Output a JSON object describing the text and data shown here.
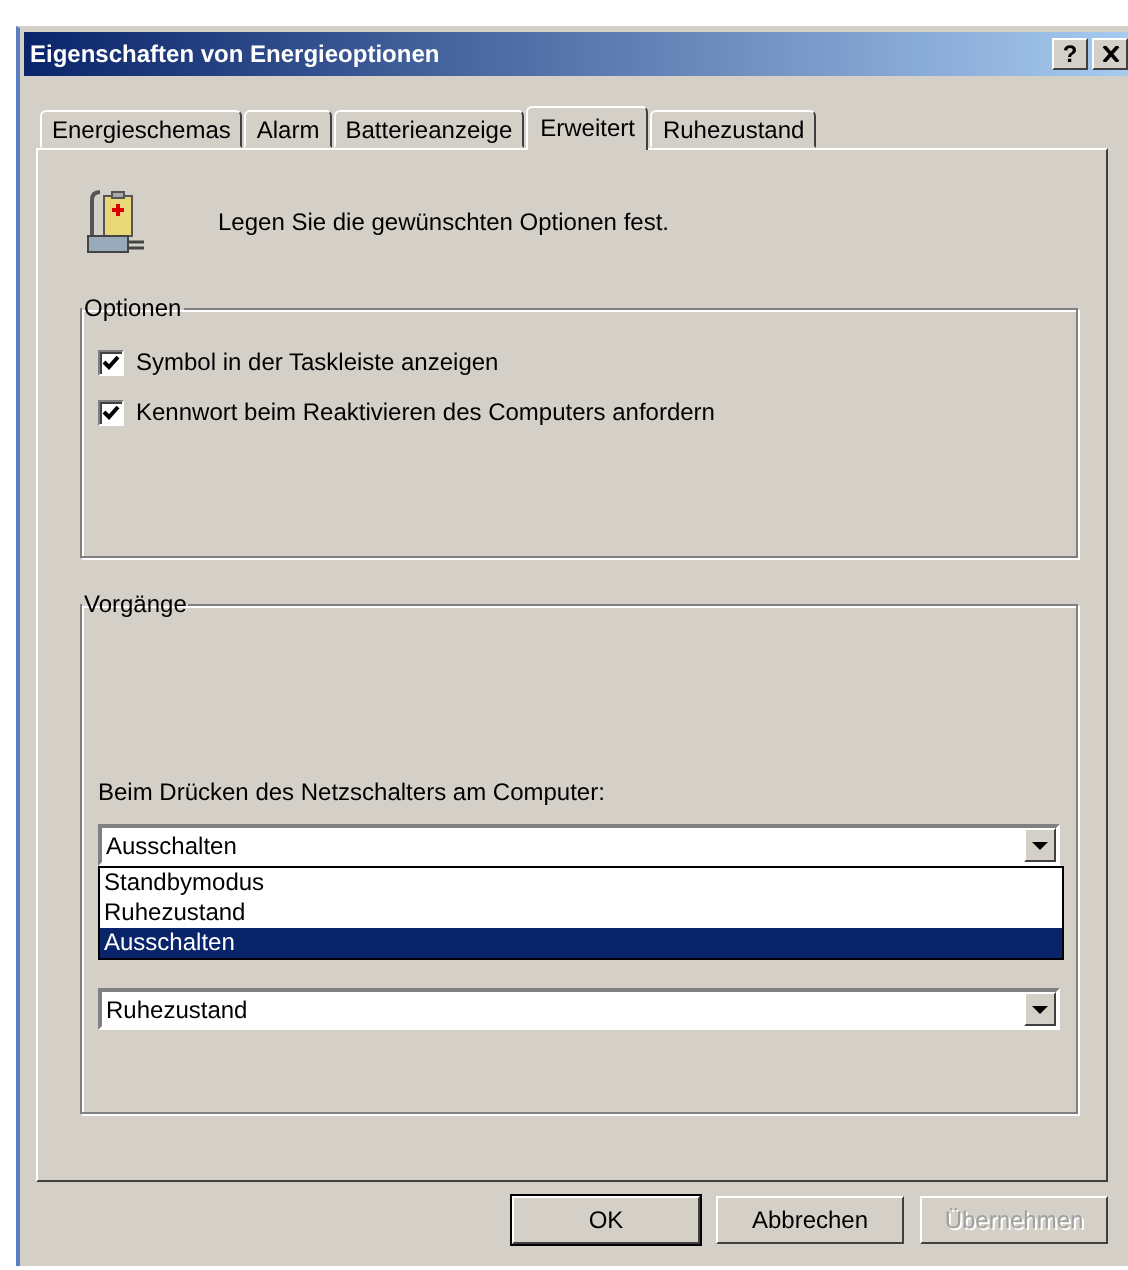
{
  "window": {
    "title": "Eigenschaften von Energieoptionen",
    "help_button": "?"
  },
  "tabs": [
    {
      "label": "Energieschemas",
      "selected": false
    },
    {
      "label": "Alarm",
      "selected": false
    },
    {
      "label": "Batterieanzeige",
      "selected": false
    },
    {
      "label": "Erweitert",
      "selected": true
    },
    {
      "label": "Ruhezustand",
      "selected": false
    }
  ],
  "intro": "Legen Sie die gewünschten Optionen fest.",
  "options": {
    "title": "Optionen",
    "checkboxes": [
      {
        "label": "Symbol in der Taskleiste anzeigen",
        "checked": true
      },
      {
        "label": "Kennwort beim Reaktivieren des Computers anfordern",
        "checked": true
      }
    ]
  },
  "actions": {
    "title": "Vorgänge",
    "power_button_label": "Beim Drücken des Netzschalters am Computer:",
    "power_button_value": "Ausschalten",
    "dropdown_items": [
      {
        "label": "Standbymodus",
        "selected": false
      },
      {
        "label": "Ruhezustand",
        "selected": false
      },
      {
        "label": "Ausschalten",
        "selected": true
      }
    ],
    "second_value": "Ruhezustand"
  },
  "buttons": [
    {
      "label": "OK",
      "default": true,
      "disabled": false
    },
    {
      "label": "Abbrechen",
      "default": false,
      "disabled": false
    },
    {
      "label": "Übernehmen",
      "default": false,
      "disabled": true
    }
  ]
}
